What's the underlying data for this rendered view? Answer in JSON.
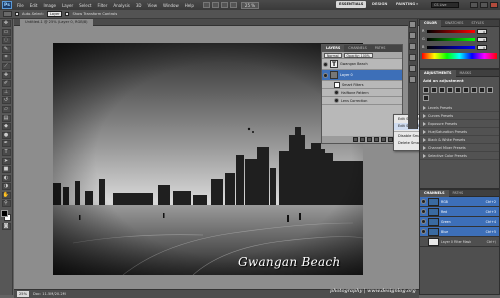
{
  "app": {
    "logo": "Ps"
  },
  "menubar": {
    "items": [
      "File",
      "Edit",
      "Image",
      "Layer",
      "Select",
      "Filter",
      "Analysis",
      "3D",
      "View",
      "Window",
      "Help"
    ],
    "zoom": "25 %",
    "workspaces": {
      "essentials": "ESSENTIALS",
      "design": "DESIGN",
      "painting": "PAINTING",
      "more": "»"
    },
    "cs_live": "CS Live"
  },
  "options": {
    "auto_select_label": "Auto-Select:",
    "auto_select_value": "Layer",
    "transform_label": "Show Transform Controls"
  },
  "document": {
    "tab_label": "Untitled-1 @ 25% (Layer 0, RGB/8)",
    "caption": "Gwangan Beach"
  },
  "status": {
    "zoom": "25%",
    "info": "Doc: 11.5M/20.2M"
  },
  "layers_float": {
    "tabs": [
      "LAYERS",
      "CHANNELS",
      "PATHS"
    ],
    "blend": "Normal",
    "opacity_label": "Opacity: 100%",
    "rows": [
      {
        "name": "Gwangan Beach",
        "kind": "text",
        "thumb": "T"
      },
      {
        "name": "Layer 0",
        "kind": "smart"
      },
      {
        "name": "Smart Filters",
        "kind": "sub"
      },
      {
        "name": "Halftone Pattern",
        "kind": "sub"
      },
      {
        "name": "Lens Correction",
        "kind": "sub"
      }
    ]
  },
  "context_menu": {
    "items": [
      "Edit Smart Filter Blending Options...",
      "Edit Smart Filter...",
      "Disable Smart Filter",
      "Delete Smart Filter"
    ]
  },
  "color_panel": {
    "tabs": [
      "COLOR",
      "SWATCHES",
      "STYLES"
    ],
    "sliders": [
      {
        "label": "R",
        "value": "0",
        "color": "#e33"
      },
      {
        "label": "G",
        "value": "0",
        "color": "#3d3"
      },
      {
        "label": "B",
        "value": "0",
        "color": "#44f"
      }
    ]
  },
  "adjustments": {
    "tabs": [
      "ADJUSTMENTS",
      "MASKS"
    ],
    "title": "Add an adjustment",
    "presets": [
      "Levels Presets",
      "Curves Presets",
      "Exposure Presets",
      "Hue/Saturation Presets",
      "Black & White Presets",
      "Channel Mixer Presets",
      "Selective Color Presets"
    ]
  },
  "layers_panel": {
    "tabs": [
      "CHANNELS",
      "PATHS"
    ],
    "rows": [
      {
        "name": "RGB",
        "shortcut": "Ctrl+2",
        "thumb": "#3a6aa0"
      },
      {
        "name": "Red",
        "shortcut": "Ctrl+3",
        "thumb": "#3a6aa0"
      },
      {
        "name": "Green",
        "shortcut": "Ctrl+4",
        "thumb": "#3a6aa0"
      },
      {
        "name": "Blue",
        "shortcut": "Ctrl+5",
        "thumb": "#3a6aa0"
      },
      {
        "name": "Layer 0 Filter Mask",
        "shortcut": "Ctrl+\\",
        "thumb": "#e8e8e8"
      }
    ]
  },
  "watermark": "photography | www.designlog.org",
  "colors": {
    "accent": "#3d6fb8",
    "selected_row": "#3d6fb8"
  }
}
